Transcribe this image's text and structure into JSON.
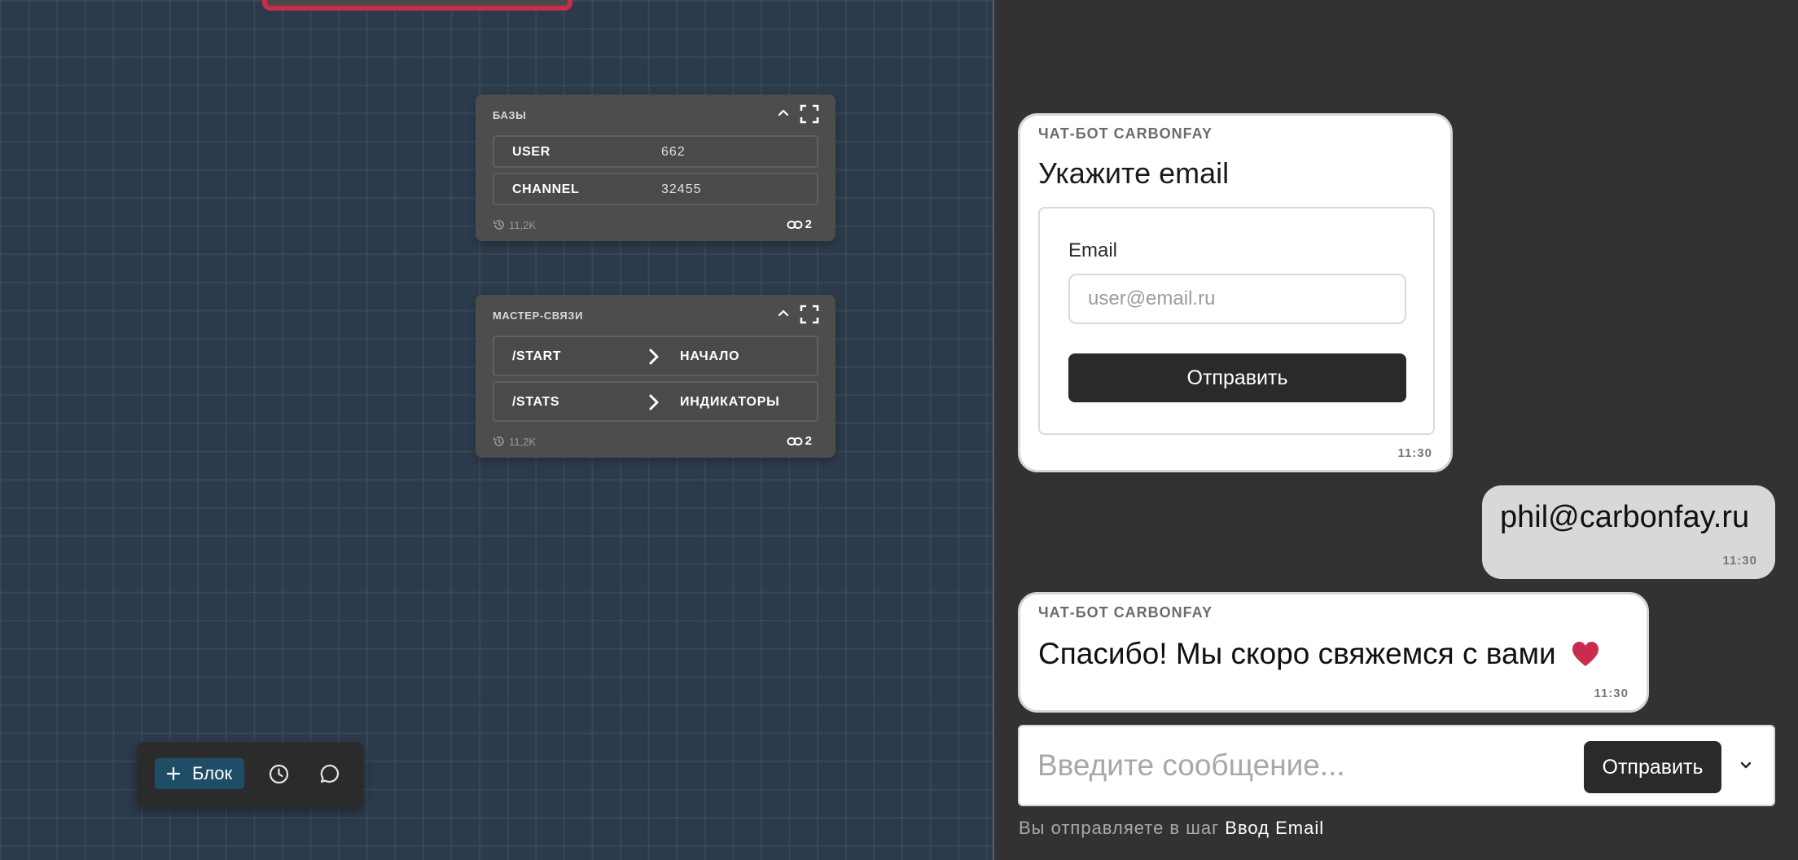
{
  "canvas": {
    "nodes": [
      {
        "title": "БАЗЫ",
        "rows": [
          {
            "key": "USER",
            "value": "662"
          },
          {
            "key": "CHANNEL",
            "value": "32455"
          }
        ],
        "history": "11,2K",
        "links": "2"
      },
      {
        "title": "МАСТЕР-СВЯЗИ",
        "rows": [
          {
            "key": "/START",
            "target": "НАЧАЛО"
          },
          {
            "key": "/STATS",
            "target": "ИНДИКАТОРЫ"
          }
        ],
        "history": "11,2K",
        "links": "2"
      }
    ],
    "toolbar": {
      "add_block_label": "Блок"
    }
  },
  "chat": {
    "messages": [
      {
        "sender": "ЧАТ-БОТ CARBONFAY",
        "title": "Укажите email",
        "field_label": "Email",
        "field_placeholder": "user@email.ru",
        "button_label": "Отправить",
        "time": "11:30"
      },
      {
        "text": "phil@carbonfay.ru",
        "time": "11:30"
      },
      {
        "sender": "ЧАТ-БОТ CARBONFAY",
        "text": "Спасибо! Мы скоро свяжемся с вами",
        "time": "11:30"
      }
    ],
    "composer": {
      "placeholder": "Введите сообщение...",
      "send_label": "Отправить"
    },
    "step_hint": {
      "prefix": "Вы отправляете в шаг",
      "step": "Ввод Email"
    }
  },
  "colors": {
    "canvas_bg": "#2c3b4b",
    "panel_bg": "#323232",
    "accent_red": "#c92c4e",
    "add_block_bg": "#1f4d66"
  },
  "icons": [
    "chevron-up-icon",
    "expand-icon",
    "history-icon",
    "link-icon",
    "chevron-right-icon",
    "plus-icon",
    "clock-icon",
    "comment-icon",
    "heart-icon",
    "chevron-down-icon"
  ]
}
